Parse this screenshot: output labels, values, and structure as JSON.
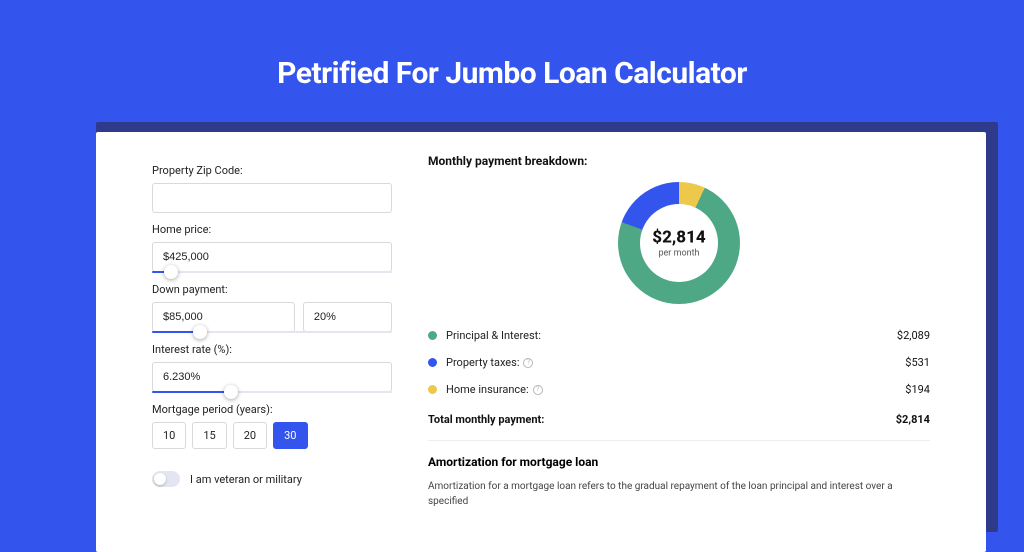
{
  "header": {
    "title": "Petrified For Jumbo Loan Calculator"
  },
  "form": {
    "zip_label": "Property Zip Code:",
    "zip_value": "",
    "price_label": "Home price:",
    "price_value": "$425,000",
    "price_slider_pct": 8,
    "down_label": "Down payment:",
    "down_value": "$85,000",
    "down_pct_value": "20%",
    "down_slider_pct": 20,
    "rate_label": "Interest rate (%):",
    "rate_value": "6.230%",
    "rate_slider_pct": 33,
    "period_label": "Mortgage period (years):",
    "period_options": [
      "10",
      "15",
      "20",
      "30"
    ],
    "period_active_index": 3,
    "veteran_label": "I am veteran or military",
    "veteran_on": false
  },
  "breakdown": {
    "title": "Monthly payment breakdown:",
    "center_amount": "$2,814",
    "center_sub": "per month",
    "items": [
      {
        "label": "Principal & Interest:",
        "value": "$2,089",
        "color": "#4ea885",
        "info": false
      },
      {
        "label": "Property taxes:",
        "value": "$531",
        "color": "#3355ee",
        "info": true
      },
      {
        "label": "Home insurance:",
        "value": "$194",
        "color": "#eec84a",
        "info": true
      }
    ],
    "total_label": "Total monthly payment:",
    "total_value": "$2,814"
  },
  "amortization": {
    "title": "Amortization for mortgage loan",
    "text": "Amortization for a mortgage loan refers to the gradual repayment of the loan principal and interest over a specified"
  },
  "chart_data": {
    "type": "pie",
    "title": "Monthly payment breakdown",
    "series": [
      {
        "name": "Principal & Interest",
        "value": 2089,
        "color": "#4ea885"
      },
      {
        "name": "Property taxes",
        "value": 531,
        "color": "#3355ee"
      },
      {
        "name": "Home insurance",
        "value": 194,
        "color": "#eec84a"
      }
    ],
    "total": 2814,
    "unit": "USD/month"
  }
}
